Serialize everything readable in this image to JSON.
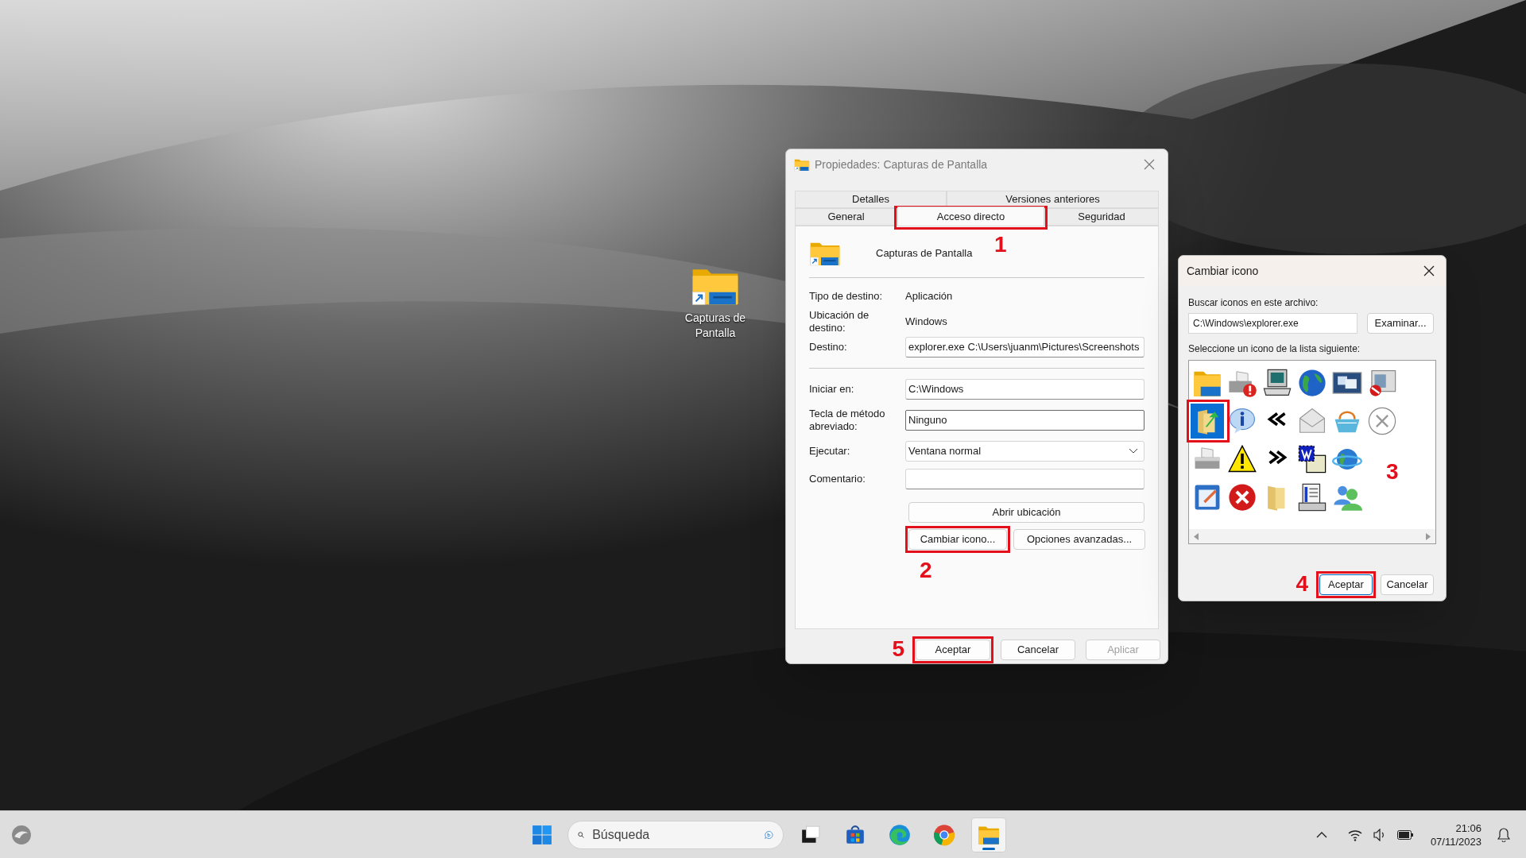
{
  "desktop_icons": [
    {
      "label": "Capturas de Pantalla"
    }
  ],
  "properties_dialog": {
    "title": "Propiedades: Capturas de Pantalla",
    "tab_rows": [
      [
        {
          "label": "Detalles",
          "selected": false
        },
        {
          "label": "Versiones anteriores",
          "selected": false
        }
      ],
      [
        {
          "label": "General",
          "selected": false
        },
        {
          "label": "Acceso directo",
          "selected": true,
          "callout": "1"
        },
        {
          "label": "Seguridad",
          "selected": false
        }
      ]
    ],
    "shortcut_name": "Capturas de Pantalla",
    "summary": [
      {
        "kind": "info",
        "label": "Tipo de destino:",
        "value": "Aplicación"
      },
      {
        "kind": "info",
        "label": "Ubicación de destino:",
        "value": "Windows"
      },
      {
        "kind": "input",
        "label": "Destino:",
        "value": "explorer.exe C:\\Users\\juanm\\Pictures\\Screenshots"
      }
    ],
    "fields": [
      {
        "kind": "input",
        "label": "Iniciar en:",
        "value": "C:\\Windows"
      },
      {
        "kind": "hotkey",
        "label": "Tecla de método abreviado:",
        "value": "Ninguno"
      },
      {
        "kind": "dropdown",
        "label": "Ejecutar:",
        "value": "Ventana normal"
      },
      {
        "kind": "input",
        "label": "Comentario:"
      }
    ],
    "open_location_button": "Abrir ubicación",
    "action_buttons": [
      {
        "label": "Cambiar icono...",
        "callout": "2"
      },
      {
        "label": "Opciones avanzadas..."
      }
    ],
    "footer_buttons": [
      {
        "label": "Aceptar",
        "disabled": false,
        "callout": "5"
      },
      {
        "label": "Cancelar",
        "disabled": false
      },
      {
        "label": "Aplicar",
        "disabled": true
      }
    ]
  },
  "change_icon_dialog": {
    "title": "Cambiar icono",
    "file_label": "Buscar iconos en este archivo:",
    "file_path": "C:\\Windows\\explorer.exe",
    "browse_button": "Examinar...",
    "list_label": "Seleccione un icono de la lista siguiente:",
    "list_callout": "3",
    "icons": [
      {
        "kind": "folder",
        "selected": false
      },
      {
        "kind": "folder-arrow",
        "selected": true
      },
      {
        "kind": "printer",
        "selected": false
      },
      {
        "kind": "edit-window",
        "selected": false
      },
      {
        "kind": "printer-help",
        "selected": false
      },
      {
        "kind": "info",
        "selected": false
      },
      {
        "kind": "warning",
        "selected": false
      },
      {
        "kind": "error",
        "selected": false
      },
      {
        "kind": "computer",
        "selected": false
      },
      {
        "kind": "rewind",
        "selected": false
      },
      {
        "kind": "forward",
        "selected": false
      },
      {
        "kind": "folder-beige",
        "selected": false
      },
      {
        "kind": "globe",
        "selected": false
      },
      {
        "kind": "envelope",
        "selected": false
      },
      {
        "kind": "word-doc",
        "selected": false
      },
      {
        "kind": "list-window",
        "selected": false
      },
      {
        "kind": "screens",
        "selected": false
      },
      {
        "kind": "basket",
        "selected": false
      },
      {
        "kind": "globe-ring",
        "selected": false
      },
      {
        "kind": "users",
        "selected": false
      },
      {
        "kind": "blocked-window",
        "selected": false
      },
      {
        "kind": "cancel-circle",
        "selected": false
      }
    ],
    "buttons": [
      {
        "label": "Aceptar",
        "default": true,
        "callout": "4"
      },
      {
        "label": "Cancelar",
        "default": false
      }
    ]
  },
  "taskbar": {
    "search_placeholder": "Búsqueda",
    "apps": [
      {
        "kind": "task-view",
        "active": false
      },
      {
        "kind": "store",
        "active": false
      },
      {
        "kind": "edge",
        "active": false
      },
      {
        "kind": "chrome",
        "active": false
      },
      {
        "kind": "explorer",
        "active": true
      }
    ],
    "time": "21:06",
    "date": "07/11/2023"
  }
}
